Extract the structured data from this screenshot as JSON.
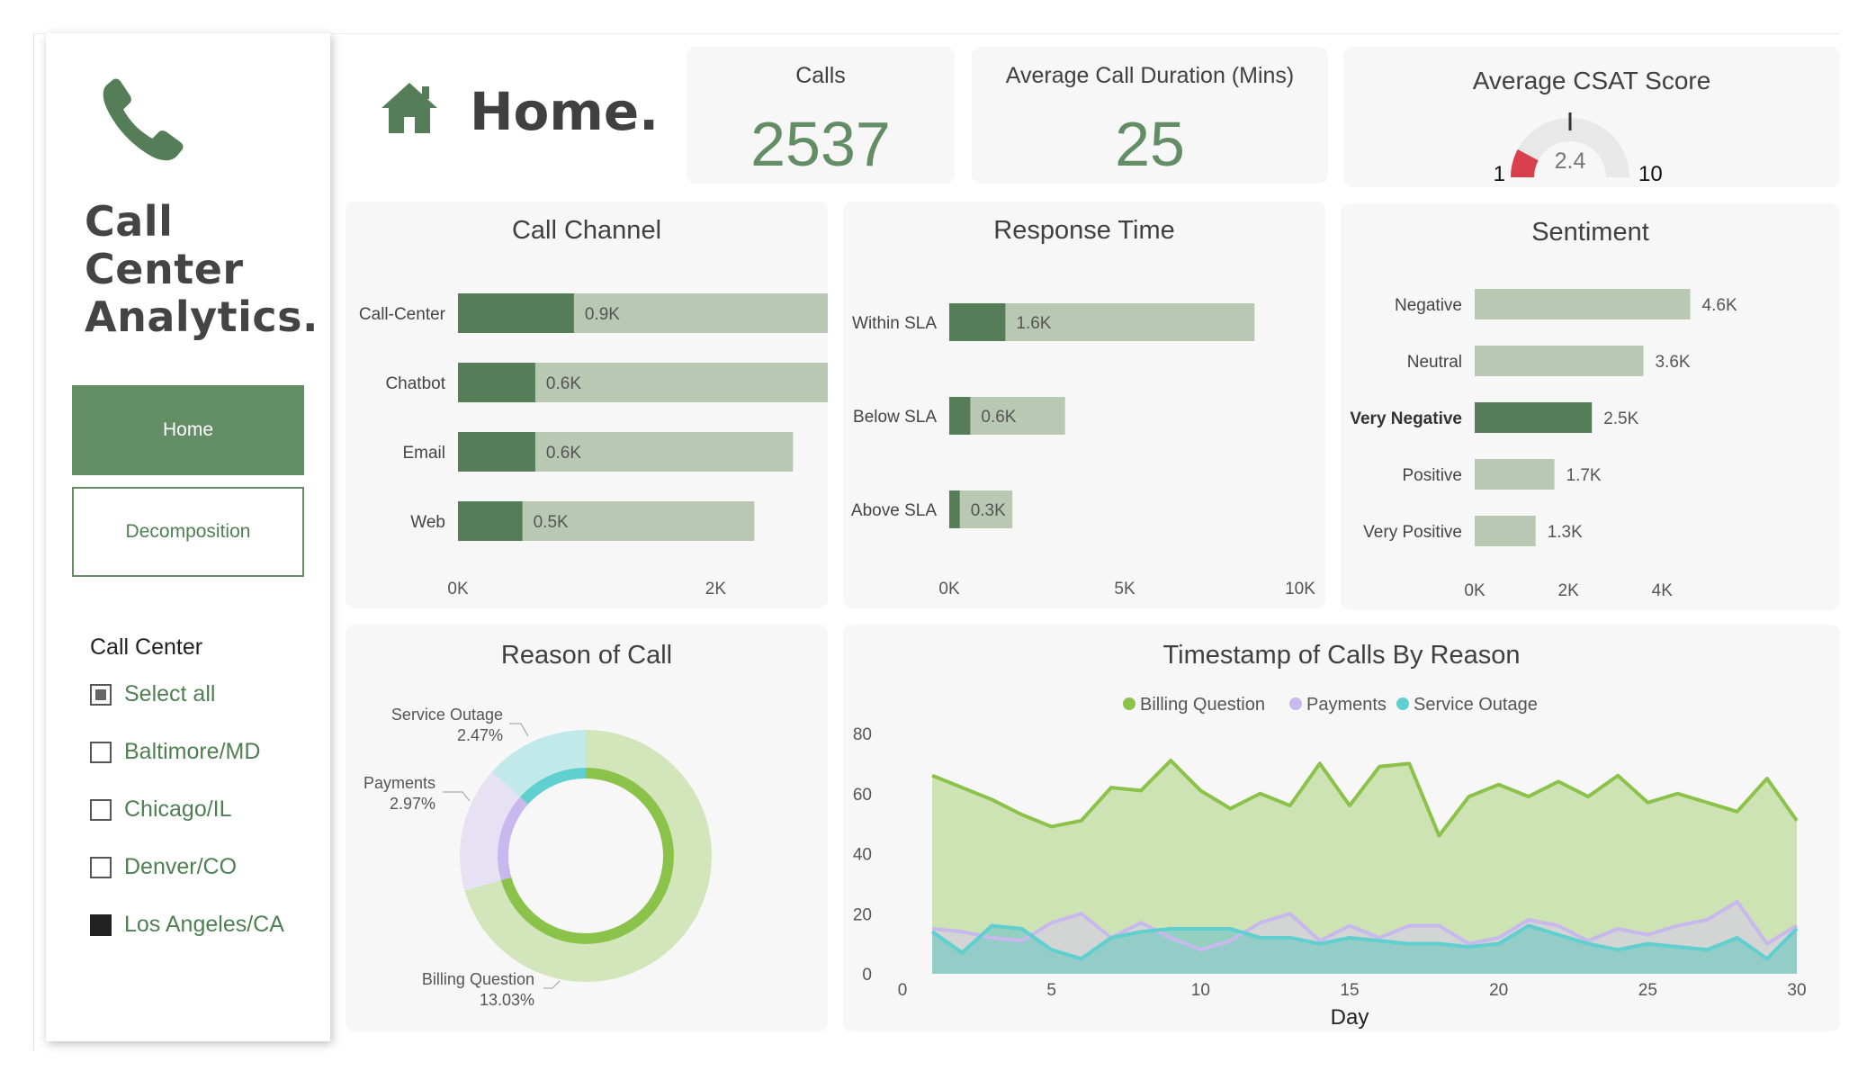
{
  "sidebar": {
    "brand_lines": [
      "Call",
      "Center",
      "Analytics."
    ],
    "nav": {
      "home": "Home",
      "decomposition": "Decomposition"
    },
    "slicer": {
      "title": "Call Center",
      "items": [
        {
          "label": "Select all",
          "state": "partial"
        },
        {
          "label": "Baltimore/MD",
          "state": "unchecked"
        },
        {
          "label": "Chicago/IL",
          "state": "unchecked"
        },
        {
          "label": "Denver/CO",
          "state": "unchecked"
        },
        {
          "label": "Los Angeles/CA",
          "state": "checked"
        }
      ]
    }
  },
  "header": {
    "title": "Home."
  },
  "kpis": {
    "calls": {
      "label": "Calls",
      "value": "2537"
    },
    "duration": {
      "label": "Average Call Duration (Mins)",
      "value": "25"
    },
    "csat": {
      "label": "Average CSAT Score",
      "value": "2.4",
      "min": "1",
      "max": "10",
      "score": 2.4,
      "target": 5.5
    }
  },
  "colors": {
    "dark_green": "#557e58",
    "light_green": "#b8c8b2",
    "panel_bg": "#f7f7f7",
    "accent": "#638e65",
    "gauge_red": "#d9404d",
    "billing": "#8bc34a",
    "payments": "#c9b8ee",
    "outage": "#5fcfcf"
  },
  "charts": {
    "call_channel": {
      "title": "Call Channel",
      "type": "bar",
      "categories": [
        "Call-Center",
        "Chatbot",
        "Email",
        "Web"
      ],
      "totals": [
        3.8,
        2.9,
        2.6,
        2.3
      ],
      "selected": [
        0.9,
        0.6,
        0.6,
        0.5
      ],
      "labels": [
        "0.9K",
        "0.6K",
        "0.6K",
        "0.5K"
      ],
      "xticks": [
        "0K",
        "2K",
        "4K"
      ],
      "xmax": 5
    },
    "response_time": {
      "title": "Response Time",
      "type": "bar",
      "categories": [
        "Within SLA",
        "Below SLA",
        "Above SLA"
      ],
      "totals": [
        8.7,
        3.3,
        1.8
      ],
      "selected": [
        1.6,
        0.6,
        0.3
      ],
      "labels": [
        "1.6K",
        "0.6K",
        "0.3K"
      ],
      "xticks": [
        "0K",
        "5K",
        "10K"
      ],
      "xmax": 10
    },
    "sentiment": {
      "title": "Sentiment",
      "type": "bar",
      "categories": [
        "Negative",
        "Neutral",
        "Very Negative",
        "Positive",
        "Very Positive"
      ],
      "values": [
        4.6,
        3.6,
        2.5,
        1.7,
        1.3
      ],
      "labels": [
        "4.6K",
        "3.6K",
        "2.5K",
        "1.7K",
        "1.3K"
      ],
      "highlight_index": 2,
      "xticks": [
        "0K",
        "2K",
        "4K"
      ],
      "xmax": 5
    },
    "reason": {
      "title": "Reason of Call",
      "type": "pie",
      "slices": [
        {
          "name": "Billing Question",
          "label": "Billing Question",
          "pct_label": "13.03%",
          "value": 13.03
        },
        {
          "name": "Payments",
          "label": "Payments",
          "pct_label": "2.97%",
          "value": 2.97
        },
        {
          "name": "Service Outage",
          "label": "Service Outage",
          "pct_label": "2.47%",
          "value": 2.47
        }
      ]
    },
    "timestamp": {
      "title": "Timestamp of Calls By Reason",
      "type": "area",
      "xlabel": "Day",
      "xticks": [
        "0",
        "5",
        "10",
        "15",
        "20",
        "25",
        "30"
      ],
      "yticks": [
        "0",
        "20",
        "40",
        "60",
        "80"
      ],
      "ylim": [
        0,
        80
      ],
      "xlim": [
        0,
        30
      ],
      "x": [
        1,
        2,
        3,
        4,
        5,
        6,
        7,
        8,
        9,
        10,
        11,
        12,
        13,
        14,
        15,
        16,
        17,
        18,
        19,
        20,
        21,
        22,
        23,
        24,
        25,
        26,
        27,
        28,
        29,
        30
      ],
      "series": [
        {
          "name": "Billing Question",
          "values": [
            66,
            62,
            58,
            53,
            49,
            51,
            62,
            61,
            71,
            61,
            55,
            60,
            56,
            70,
            56,
            69,
            70,
            46,
            59,
            63,
            59,
            64,
            59,
            66,
            57,
            60,
            57,
            54,
            65,
            51
          ]
        },
        {
          "name": "Payments",
          "values": [
            15,
            14,
            12,
            11,
            17,
            20,
            12,
            17,
            12,
            8,
            11,
            17,
            20,
            11,
            16,
            12,
            16,
            16,
            10,
            12,
            18,
            16,
            11,
            15,
            13,
            16,
            18,
            24,
            10,
            16
          ]
        },
        {
          "name": "Service Outage",
          "values": [
            14,
            7,
            16,
            15,
            8,
            5,
            12,
            14,
            15,
            15,
            15,
            12,
            12,
            10,
            12,
            11,
            10,
            10,
            9,
            10,
            16,
            13,
            10,
            8,
            10,
            9,
            8,
            12,
            5,
            15
          ]
        }
      ]
    }
  }
}
